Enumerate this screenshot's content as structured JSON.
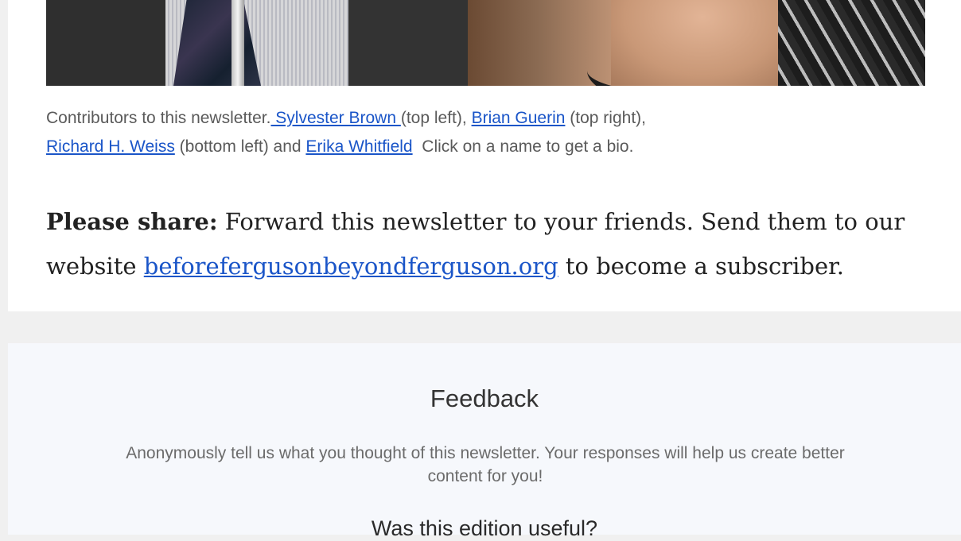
{
  "caption": {
    "intro": "Contributors to this newsletter.",
    "contributors": [
      {
        "name": " Sylvester Brown ",
        "position": "(top left), "
      },
      {
        "name": "Brian Guerin",
        "position": " (top right), "
      },
      {
        "name": "Richard H. Weiss",
        "position": " (bottom left) and "
      },
      {
        "name": "Erika Whitfield",
        "position": ""
      }
    ],
    "outro": "  Click on a name to get a bio."
  },
  "share": {
    "label": "Please share:",
    "text_before": " Forward this newsletter to your friends. Send them to our website ",
    "link": "beforefergusonbeyondferguson.org",
    "text_after": " to become a subscriber."
  },
  "feedback": {
    "title": "Feedback",
    "description": "Anonymously tell us what you thought of this newsletter. Your responses will help us create better content for you!",
    "question": "Was this edition useful?"
  },
  "colors": {
    "link": "#1a55c8",
    "page_bg": "#f0f0f0",
    "feedback_bg": "#f6f8fc"
  }
}
